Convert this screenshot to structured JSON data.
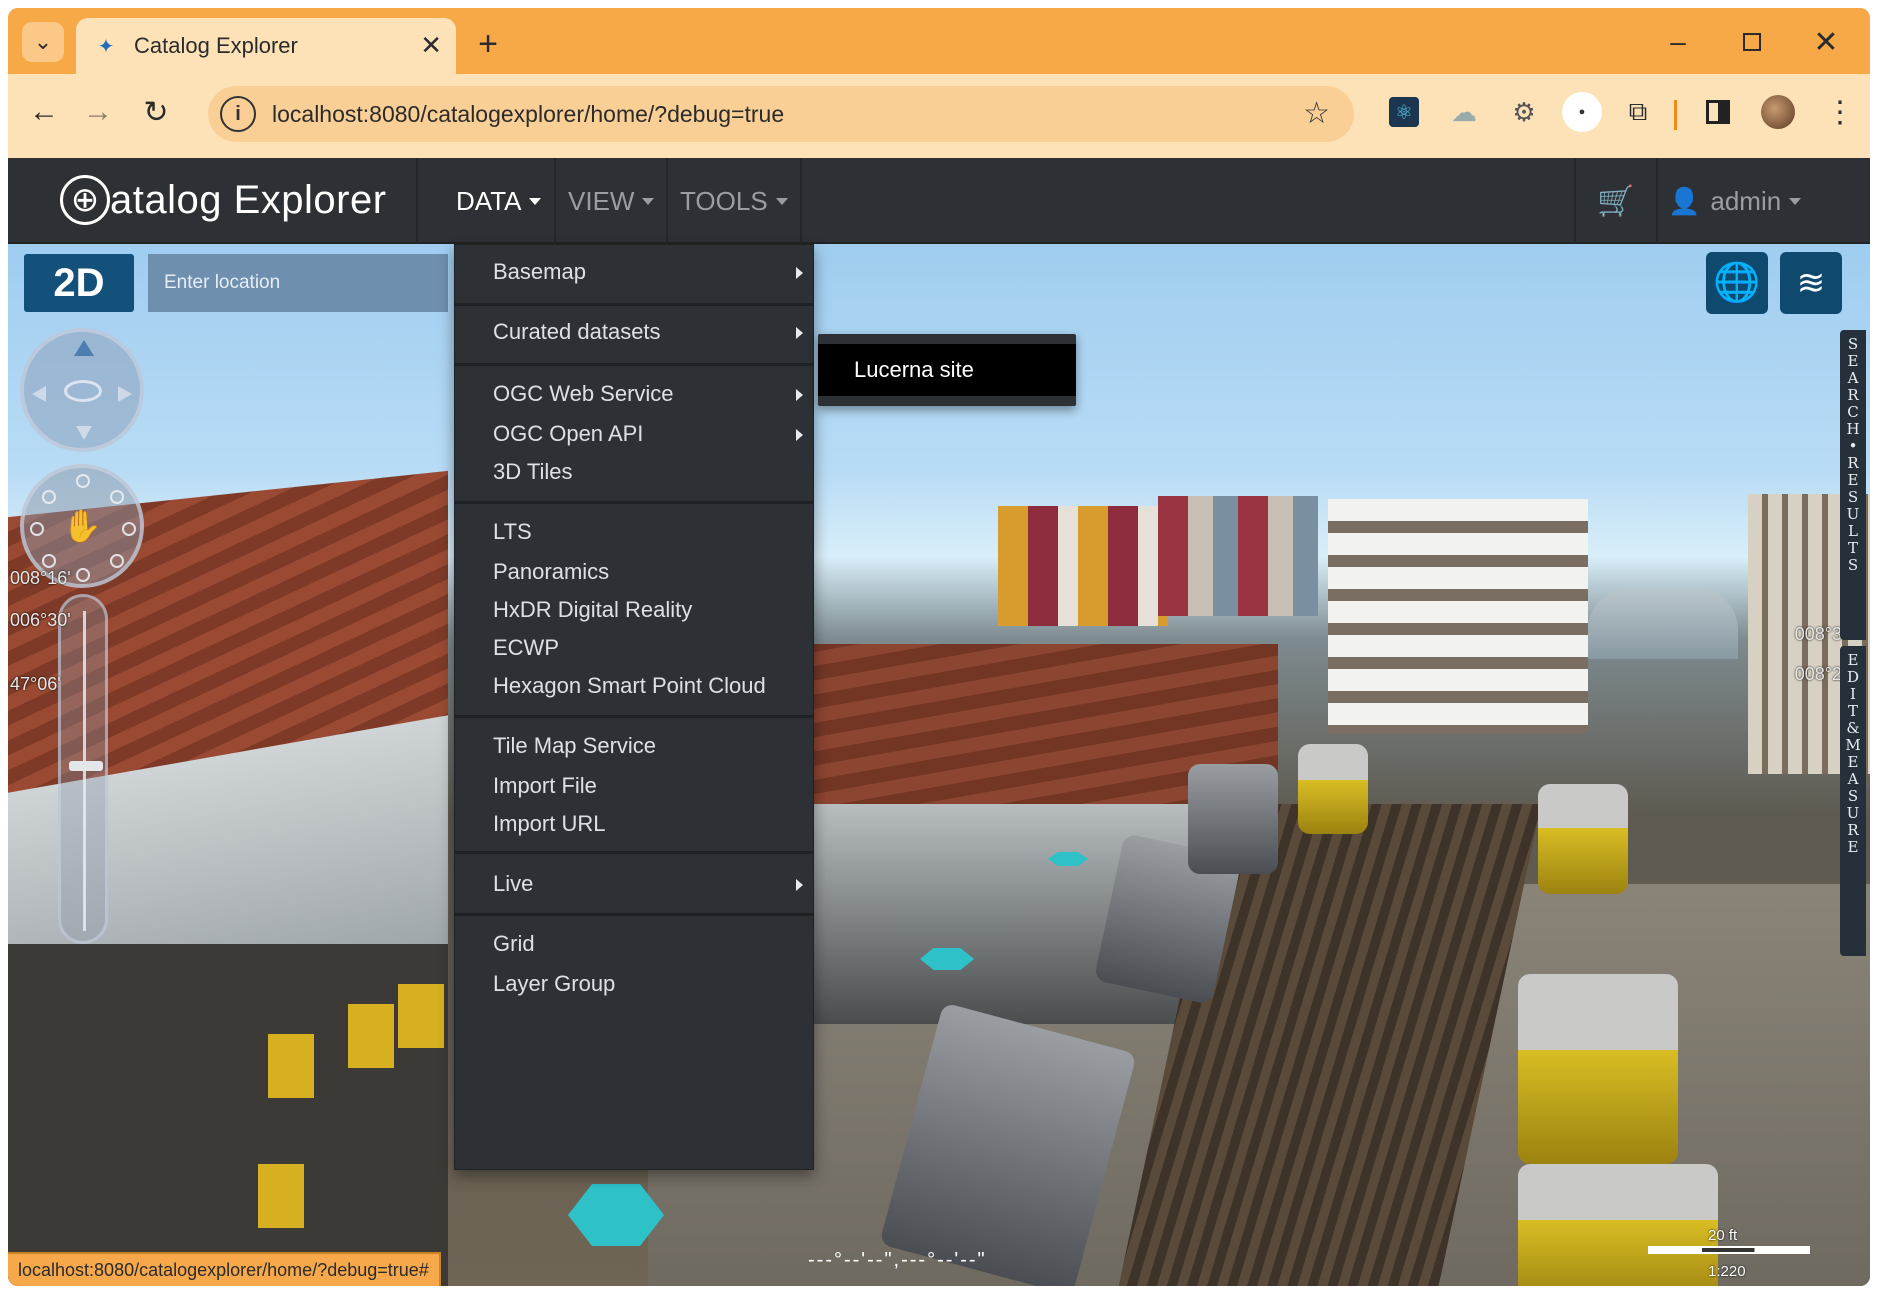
{
  "browser": {
    "tab_title": "Catalog Explorer",
    "url": "localhost:8080/catalogexplorer/home/?debug=true",
    "status_url": "localhost:8080/catalogexplorer/home/?debug=true#"
  },
  "app": {
    "brand": "atalog Explorer",
    "nav": {
      "data": "DATA",
      "view": "VIEW",
      "tools": "TOOLS",
      "user": "admin"
    }
  },
  "map": {
    "mode_button": "2D",
    "location_placeholder": "Enter location",
    "coords_left": [
      "008°16'",
      "006°30'",
      "47°06'"
    ],
    "coords_right": [
      "008°3",
      "008°2"
    ],
    "side_tabs": {
      "search_results": "SEARCH•RESULTS",
      "edit_measure": "EDIT&MEASURE"
    },
    "credits": "---°--'--\",---°--'--\"",
    "scale_label": "20 ft",
    "scale_ratio": "1:220"
  },
  "data_menu": {
    "items": [
      {
        "label": "Basemap",
        "submenu": true
      },
      {
        "label": "Curated datasets",
        "submenu": true
      },
      {
        "label": "OGC Web Service",
        "submenu": true
      },
      {
        "label": "OGC Open API",
        "submenu": true
      },
      {
        "label": "3D Tiles",
        "submenu": false
      },
      {
        "label": "LTS",
        "submenu": false
      },
      {
        "label": "Panoramics",
        "submenu": false
      },
      {
        "label": "HxDR Digital Reality",
        "submenu": false
      },
      {
        "label": "ECWP",
        "submenu": false
      },
      {
        "label": "Hexagon Smart Point Cloud",
        "submenu": false
      },
      {
        "label": "Tile Map Service",
        "submenu": false
      },
      {
        "label": "Import File",
        "submenu": false
      },
      {
        "label": "Import URL",
        "submenu": false
      },
      {
        "label": "Live",
        "submenu": true
      },
      {
        "label": "Grid",
        "submenu": false
      },
      {
        "label": "Layer Group",
        "submenu": false
      }
    ],
    "submenu_curated": [
      "Lucerna site"
    ]
  },
  "colors": {
    "browser_chrome": "#f7a947",
    "toolbar": "#fde2b8",
    "app_navbar": "#2d3034",
    "menu_bg": "#2d3034",
    "map_button": "#0f4a6e"
  }
}
